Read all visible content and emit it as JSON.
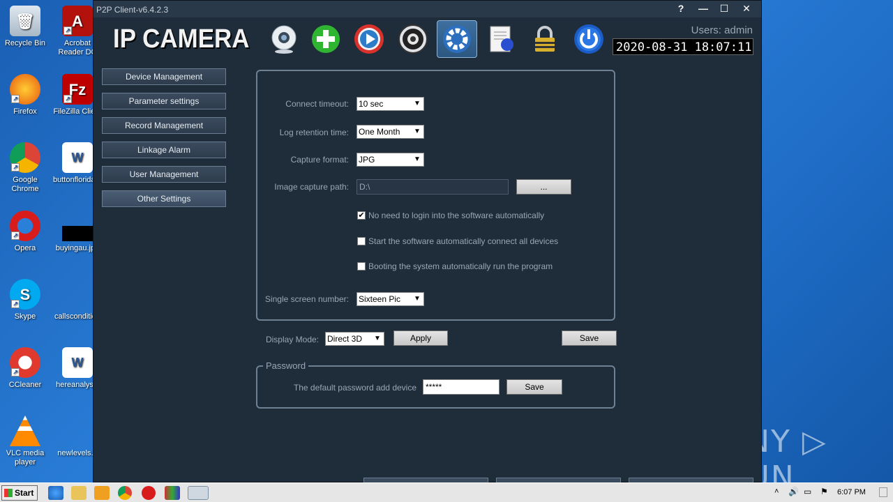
{
  "desktop": {
    "icons": [
      {
        "label": "Recycle Bin",
        "icon": "recycle-bin-icon"
      },
      {
        "label": "Acrobat Reader DC",
        "icon": "acrobat-icon"
      },
      {
        "label": "Firefox",
        "icon": "firefox-icon"
      },
      {
        "label": "FileZilla Client",
        "icon": "filezilla-icon"
      },
      {
        "label": "Google Chrome",
        "icon": "chrome-icon"
      },
      {
        "label": "buttonflorida.rtf",
        "icon": "word-doc-icon"
      },
      {
        "label": "Opera",
        "icon": "opera-icon"
      },
      {
        "label": "buyingau.jpg",
        "icon": "image-file-icon"
      },
      {
        "label": "Skype",
        "icon": "skype-icon"
      },
      {
        "label": "callscondition",
        "icon": "file-icon"
      },
      {
        "label": "CCleaner",
        "icon": "ccleaner-icon"
      },
      {
        "label": "hereanalysis",
        "icon": "word-doc-icon"
      },
      {
        "label": "VLC media player",
        "icon": "vlc-icon"
      },
      {
        "label": "newlevels.p",
        "icon": "file-icon"
      }
    ],
    "watermark": "ANY ▷ RUN"
  },
  "window": {
    "title": "P2P Client-v6.4.2.3",
    "controls": {
      "help": "?",
      "minimize": "—",
      "maximize": "☐",
      "close": "✕"
    }
  },
  "header": {
    "logo": "IP CAMERA",
    "users": "Users: admin",
    "datetime": "2020-08-31  18:07:11",
    "toolbar": [
      "webcam-icon",
      "add-icon",
      "playback-icon",
      "ptz-icon",
      "settings-icon",
      "log-icon",
      "lock-icon",
      "power-icon"
    ]
  },
  "sidebar": {
    "items": [
      {
        "label": "Device Management"
      },
      {
        "label": "Parameter settings"
      },
      {
        "label": "Record Management"
      },
      {
        "label": "Linkage Alarm"
      },
      {
        "label": "User Management"
      },
      {
        "label": "Other Settings"
      }
    ]
  },
  "settings": {
    "connect_timeout": {
      "label": "Connect timeout:",
      "value": "10 sec"
    },
    "log_retention": {
      "label": "Log retention time:",
      "value": "One Month"
    },
    "capture_format": {
      "label": "Capture format:",
      "value": "JPG"
    },
    "capture_path": {
      "label": "Image capture path:",
      "value": "D:\\",
      "browse": "..."
    },
    "checkboxes": [
      {
        "label": "No need to login into the software automatically",
        "checked": true
      },
      {
        "label": "Start the software automatically connect all devices",
        "checked": false
      },
      {
        "label": "Booting the system automatically run the program",
        "checked": false
      }
    ],
    "single_screen": {
      "label": "Single screen number:",
      "value": "Sixteen Pic"
    },
    "display_mode": {
      "label": "Display Mode:",
      "value": "Direct 3D"
    },
    "apply": "Apply",
    "save": "Save"
  },
  "password": {
    "legend": "Password",
    "label": "The default password add device",
    "value": "*****",
    "save": "Save"
  },
  "taskbar": {
    "start": "Start",
    "time": "6:07 PM"
  }
}
